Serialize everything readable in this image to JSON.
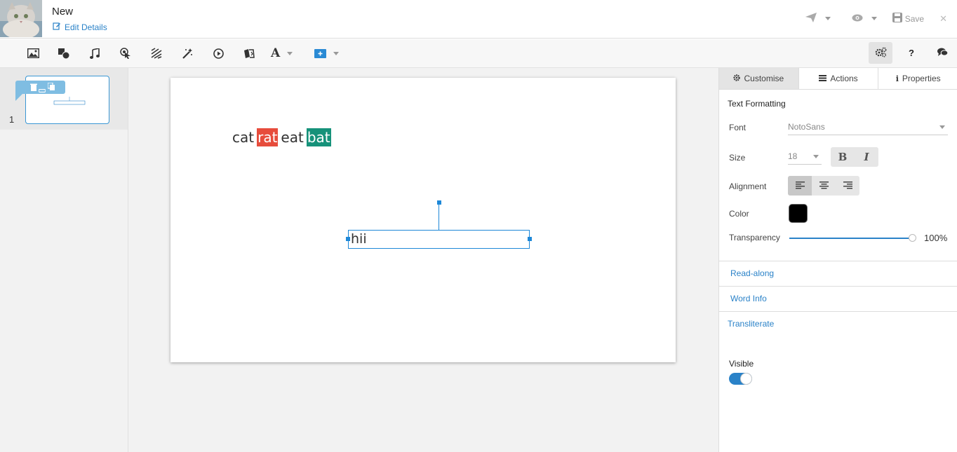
{
  "header": {
    "title": "New",
    "edit_label": "Edit Details",
    "save_label": "Save",
    "close_symbol": "✕"
  },
  "toolbar": {
    "tools": [
      "image-icon",
      "shapes-icon",
      "music-icon",
      "hotspot-icon",
      "scribble-icon",
      "magic-wand-icon",
      "play-icon",
      "cards-icon",
      "text-icon",
      "add-box-icon"
    ],
    "help_label": "?",
    "text_label": "A"
  },
  "slides": [
    {
      "number": "1"
    }
  ],
  "canvas": {
    "words": [
      {
        "text": "cat",
        "bg": ""
      },
      {
        "text": "rat",
        "bg": "#e74c3c"
      },
      {
        "text": "eat",
        "bg": ""
      },
      {
        "text": "bat",
        "bg": "#16927a"
      }
    ],
    "textbox_text": "hii"
  },
  "panel": {
    "tabs": [
      "Customise",
      "Actions",
      "Properties"
    ],
    "section_title": "Text Formatting",
    "font_label": "Font",
    "font_value": "NotoSans",
    "size_label": "Size",
    "size_value": "18",
    "bold_label": "B",
    "italic_label": "I",
    "alignment_label": "Alignment",
    "color_label": "Color",
    "color_value": "#000000",
    "transparency_label": "Transparency",
    "transparency_value": "100%",
    "read_along": "Read-along",
    "word_info": "Word Info",
    "transliterate": "Transliterate",
    "visible_label": "Visible",
    "visible_on": true
  },
  "colors": {
    "accent": "#2a82c8",
    "highlight_red": "#e74c3c",
    "highlight_green": "#16927a"
  }
}
